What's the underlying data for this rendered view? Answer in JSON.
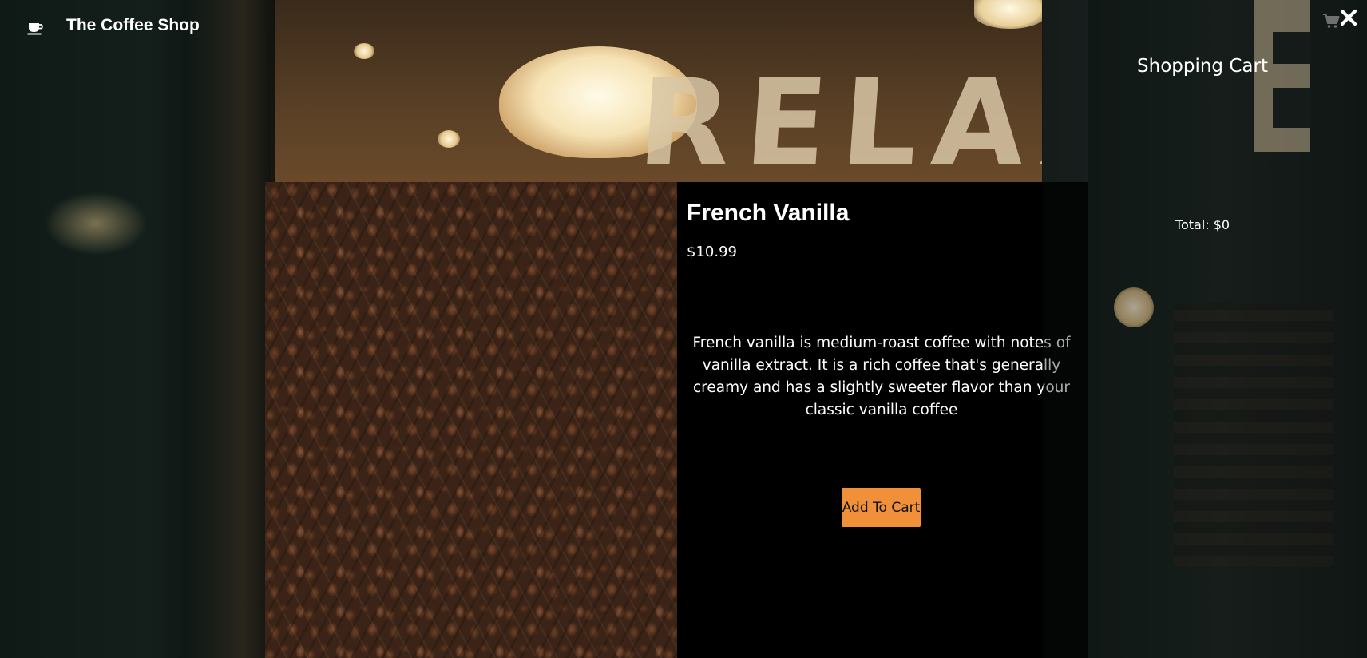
{
  "header": {
    "brand": "The Coffee Shop",
    "logo_icon": "coffee-cup-icon"
  },
  "product": {
    "title": "French Vanilla",
    "price": "$10.99",
    "description": "French vanilla is medium-roast coffee with notes of vanilla extract. It is a rich coffee that's generally creamy and has a slightly sweeter flavor than your classic vanilla coffee",
    "add_to_cart_label": "Add To Cart",
    "button_color": "#f0913a"
  },
  "cart": {
    "title": "Shopping Cart",
    "total": "Total: $0",
    "cart_icon": "shopping-cart-icon",
    "close_icon": "close-icon"
  }
}
